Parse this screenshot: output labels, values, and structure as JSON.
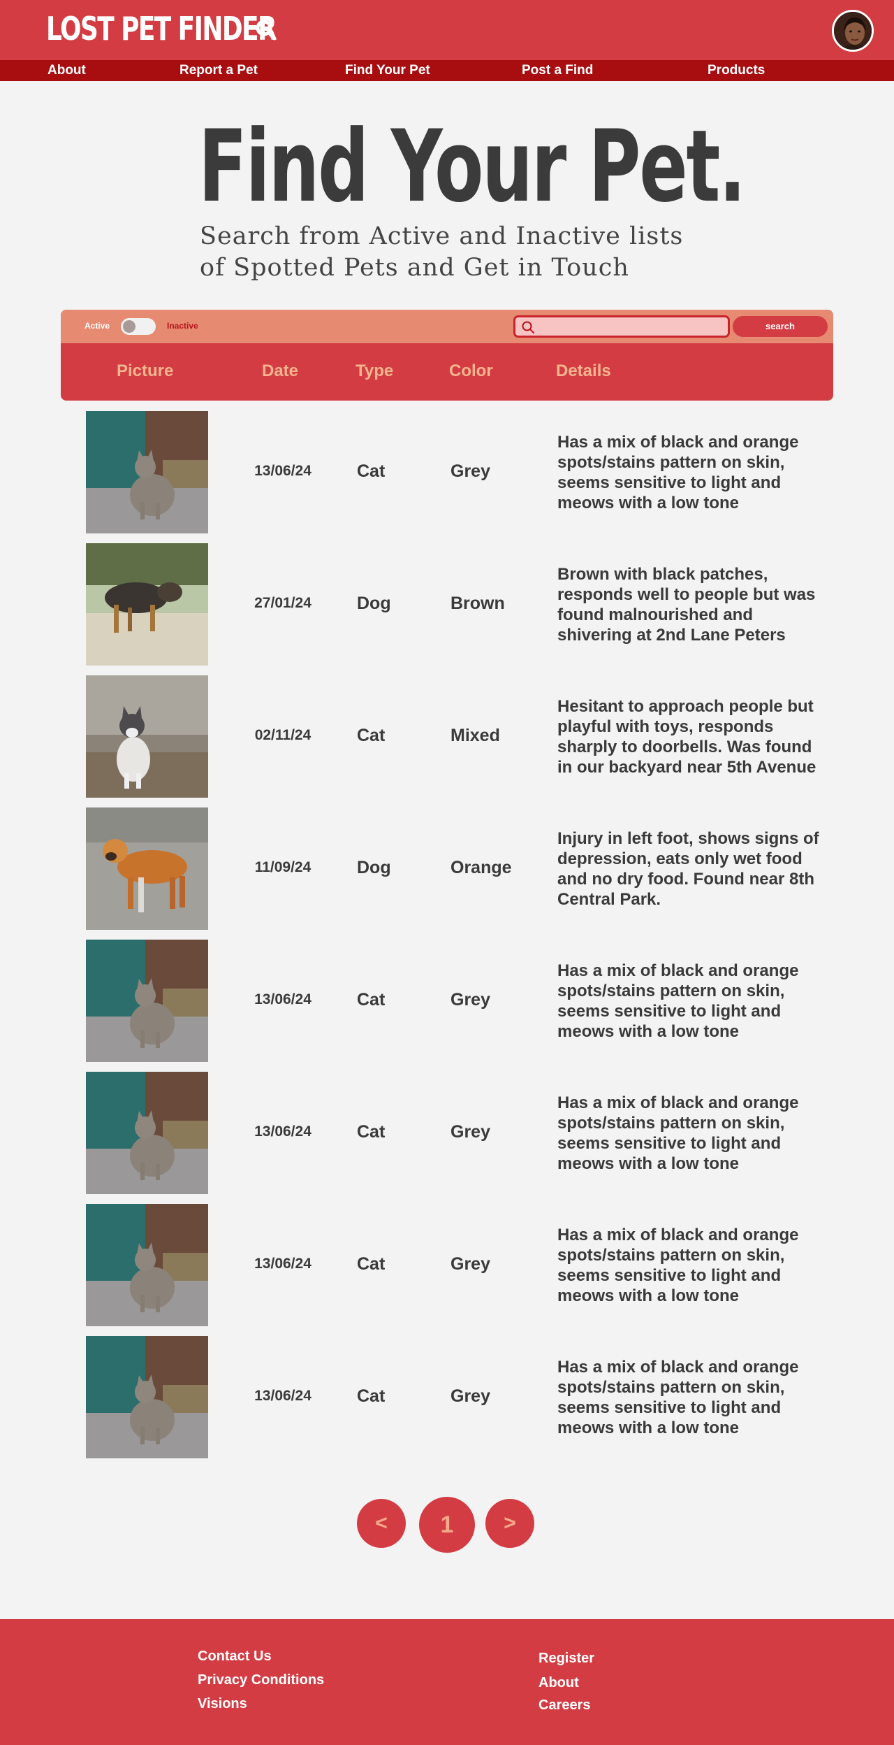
{
  "header": {
    "brand": "LOST PET FINDER",
    "search_icon": "search-icon",
    "avatar_icon": "user-avatar"
  },
  "nav": {
    "items": [
      "About",
      "Report a Pet",
      "Find Your Pet",
      "Post a Find",
      "Products"
    ]
  },
  "hero": {
    "title": "Find Your Pet.",
    "subtitle_line1": "Search from Active and Inactive lists",
    "subtitle_line2": "of Spotted Pets and Get in Touch"
  },
  "filter": {
    "active_label": "Active",
    "inactive_label": "Inactive",
    "toggle_state": "active",
    "search_value": "",
    "search_button": "search"
  },
  "table": {
    "columns": [
      "Picture",
      "Date",
      "Type",
      "Color",
      "Details"
    ],
    "rows": [
      {
        "picture": "grey-cat-photo",
        "date": "13/06/24",
        "type": "Cat",
        "color": "Grey",
        "details": "Has a mix of black and orange spots/stains pattern on skin, seems sensitive to light and meows with a low tone"
      },
      {
        "picture": "brown-dog-photo",
        "date": "27/01/24",
        "type": "Dog",
        "color": "Brown",
        "details": "Brown with black patches, responds well to people but was found malnourished and shivering at 2nd Lane Peters"
      },
      {
        "picture": "mixed-cat-photo",
        "date": "02/11/24",
        "type": "Cat",
        "color": "Mixed",
        "details": "Hesitant to approach people but playful with toys, responds sharply to doorbells. Was found in our backyard near 5th Avenue"
      },
      {
        "picture": "orange-dog-photo",
        "date": "11/09/24",
        "type": "Dog",
        "color": "Orange",
        "details": "Injury in left foot, shows signs of depression, eats only wet food and no dry food. Found near 8th Central Park."
      },
      {
        "picture": "grey-cat-photo",
        "date": "13/06/24",
        "type": "Cat",
        "color": "Grey",
        "details": "Has a mix of black and orange spots/stains pattern on skin, seems sensitive to light and meows with a low tone"
      },
      {
        "picture": "grey-cat-photo",
        "date": "13/06/24",
        "type": "Cat",
        "color": "Grey",
        "details": "Has a mix of black and orange spots/stains pattern on skin, seems sensitive to light and meows with a low tone"
      },
      {
        "picture": "grey-cat-photo",
        "date": "13/06/24",
        "type": "Cat",
        "color": "Grey",
        "details": "Has a mix of black and orange spots/stains pattern on skin, seems sensitive to light and meows with a low tone"
      },
      {
        "picture": "grey-cat-photo",
        "date": "13/06/24",
        "type": "Cat",
        "color": "Grey",
        "details": "Has a mix of black and orange spots/stains pattern on skin, seems sensitive to light and meows with a low tone"
      }
    ]
  },
  "pagination": {
    "prev": "<",
    "current": "1",
    "next": ">"
  },
  "footer": {
    "left_links": [
      "Contact Us",
      "Privacy Conditions",
      "Visions"
    ],
    "right_links": [
      "Register",
      "About",
      "Careers"
    ]
  },
  "colors": {
    "primary": "#d33c43",
    "nav_dark": "#a80d10",
    "panel_light": "#e78a72",
    "column_header": "#f6b58f",
    "background": "#f3f3f3"
  }
}
